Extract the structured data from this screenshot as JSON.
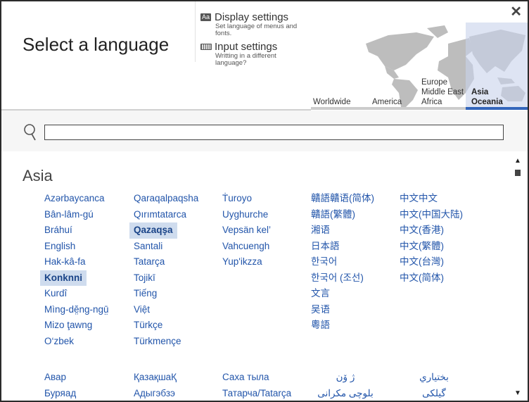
{
  "header": {
    "title": "Select a language",
    "close_icon": "close-icon",
    "display_settings": {
      "icon": "display-aa-icon",
      "title": "Display settings",
      "description": "Set language of menus and fonts."
    },
    "input_settings": {
      "icon": "keyboard-icon",
      "title": "Input settings",
      "description": "Writting in a different language?"
    }
  },
  "regions": {
    "tabs": [
      {
        "label": "Worldwide",
        "active": false
      },
      {
        "label": "America",
        "active": false
      },
      {
        "label": "Europe\nMiddle East\nAfrica",
        "lines": [
          "Europe",
          "Middle East",
          "Africa"
        ],
        "active": false
      },
      {
        "label": "Asia\nOceania",
        "lines": [
          "Asia",
          "Oceania"
        ],
        "active": true
      }
    ],
    "active_color": "#3366bb"
  },
  "search": {
    "value": "",
    "placeholder": "",
    "icon": "search-icon"
  },
  "section": {
    "title": "Asia",
    "columns": [
      [
        "Azərbaycanca",
        "Bân-lâm-gú",
        "Bráhuí",
        "English",
        "Hak-kâ-fa",
        "Konknni",
        "Kurdî",
        "Mìng-dĕ̤ng-ngṳ̄",
        "Mizo ţawng",
        "O‘zbek"
      ],
      [
        "Qaraqalpaqsha",
        "Qırımtatarca",
        "Qazaqşa",
        "Santali",
        "Tatarça",
        "Tojikī",
        "Tiếng",
        "Việt",
        "Türkçe",
        "Türkmençe"
      ],
      [
        "Ṫuroyo",
        "Uyghurche",
        "Vepsän kel’",
        "Vahcuengh",
        "Yup'ikzza"
      ],
      [
        "贛語贛语(简体)",
        "贛語(繁體)",
        "湘语",
        "日本語",
        "한국어",
        "한국어 (조선)",
        "文言",
        "吴语",
        "粵語"
      ],
      [
        "中文中文",
        "中文(中国大陆)",
        "中文(香港)",
        "中文(繁體)",
        "中文(台灣)",
        "中文(简体)"
      ]
    ],
    "selected": [
      "Konknni",
      "Qazaqşa"
    ],
    "more_rows": [
      [
        "Авар",
        "Буряад"
      ],
      [
        "ҚазақшаҚ",
        "Адыгэбзэ"
      ],
      [
        "Саха тыла",
        "Татарча/Tatarça"
      ],
      [
        "ژ ۆن",
        "بلوچی مکرانی"
      ],
      [
        "بختياري",
        "گیلکی"
      ]
    ]
  },
  "colors": {
    "link": "#2255aa",
    "selected_bg": "#cfdcee",
    "highlight_region": "#c8d2eb"
  }
}
